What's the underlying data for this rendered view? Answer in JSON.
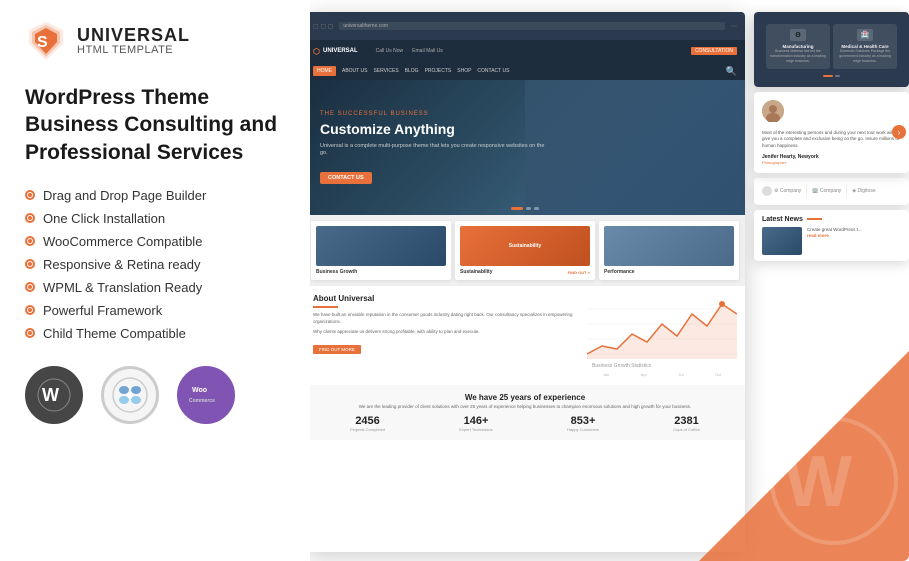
{
  "logo": {
    "title": "UNIVERSAL",
    "subtitle": "HTML TEMPLATE",
    "icon_label": "shield-logo"
  },
  "heading": {
    "line1": "WordPress Theme",
    "line2": "Business Consulting and",
    "line3": "Professional Services"
  },
  "features": [
    {
      "text": "Drag and Drop Page Builder"
    },
    {
      "text": "One Click Installation"
    },
    {
      "text": "WooCommerce Compatible"
    },
    {
      "text": "Responsive & Retina ready"
    },
    {
      "text": "WPML & Translation Ready"
    },
    {
      "text": "Powerful Framework"
    },
    {
      "text": "Child Theme Compatible"
    }
  ],
  "badges": [
    {
      "name": "WordPress",
      "label": "WordPress"
    },
    {
      "name": "Joomla",
      "label": "Joomla"
    },
    {
      "name": "WooCommerce",
      "label": "Woo"
    }
  ],
  "preview": {
    "nav_links": [
      "HOME",
      "ABOUT US",
      "SERVICES",
      "BLOG",
      "PROJECTS",
      "SHOP",
      "CONTACT US"
    ],
    "hero": {
      "small": "The Successful Business",
      "title": "Customize Anything",
      "subtitle": "Universal is a complete multi-purpose theme that lets you create responsive websites on the go.",
      "button": "CONTACT US"
    },
    "cards": [
      {
        "label": "Business Growth",
        "sublabel": ""
      },
      {
        "label": "Sustainability",
        "sublabel": "FIND OUT >"
      },
      {
        "label": "Performance",
        "sublabel": ""
      }
    ],
    "about": {
      "title": "About Universal",
      "para1": "We have built an enviable reputation in the consumer goods industry dating right back. Our consultancy specializes in empowering organizations.",
      "para2": "Why clients appreciate us delivers strong profitable, with ability to plan and execute.",
      "button": "FIND OUT MORE"
    },
    "chart": {
      "label": "Business Growth Statistics",
      "points": [
        10,
        25,
        15,
        35,
        20,
        45,
        30,
        55,
        40,
        60
      ]
    },
    "stats": {
      "title": "We have 25 years of experience",
      "subtitle": "We are the leading provider of client solutions with over 25 years of experience helping businesses to champion enormous solutions and high growth for your business.",
      "items": [
        {
          "number": "2456",
          "label": "Projects Completed"
        },
        {
          "number": "146+",
          "label": "Expert Technicians"
        },
        {
          "number": "853+",
          "label": "Happy Customers"
        },
        {
          "number": "2381",
          "label": "Cups of Coffee"
        }
      ]
    }
  },
  "side_content": {
    "services": [
      {
        "title": "Manufacturing",
        "text": "Business Material has led the transformation industry as a leading edge business."
      },
      {
        "title": "Medical & Health Care",
        "text": "Domestic Solutions Package the government industry as a leading edge business."
      }
    ],
    "testimonial": {
      "text": "Most of the interesting persons and during your next tour work will give you a complete and exclusive being on the go. Insure millions of human happiness.",
      "name": "Jenifer Hearty, Newyork",
      "role": "Photographer"
    },
    "logos": [
      "Company",
      "Digitose"
    ],
    "news": {
      "title": "Latest News",
      "item_text": "Create great WordPress t...",
      "read_more": "read more"
    }
  }
}
